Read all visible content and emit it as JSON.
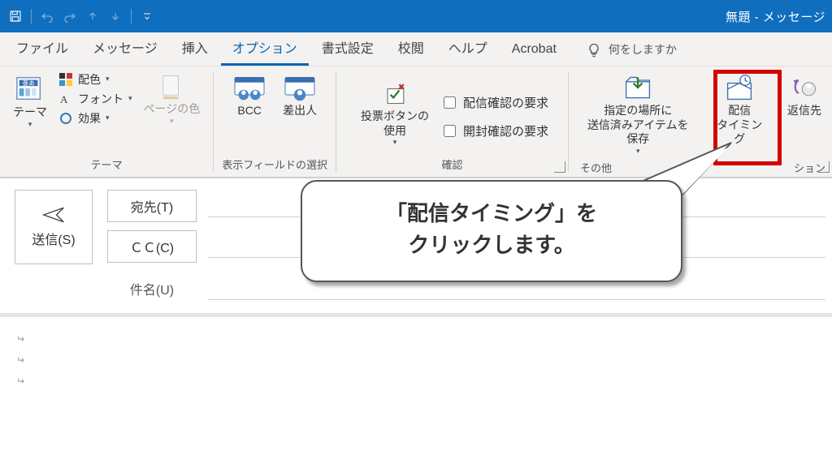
{
  "window": {
    "title": "無題 - メッセージ"
  },
  "tabs": {
    "file": "ファイル",
    "message": "メッセージ",
    "insert": "挿入",
    "options": "オプション",
    "format": "書式設定",
    "review": "校閲",
    "help": "ヘルプ",
    "acrobat": "Acrobat",
    "tellme": "何をしますか"
  },
  "ribbon": {
    "themes": {
      "group_label": "テーマ",
      "themes_btn": "テーマ",
      "colors": "配色",
      "fonts": "フォント",
      "effects": "効果",
      "page_color": "ページの色"
    },
    "show_fields": {
      "group_label": "表示フィールドの選択",
      "bcc": "BCC",
      "from": "差出人"
    },
    "tracking": {
      "group_label": "確認",
      "voting": "投票ボタンの\n使用",
      "delivery_receipt": "配信確認の要求",
      "read_receipt": "開封確認の要求"
    },
    "more_options": {
      "group_label_left": "その他",
      "group_label_right": "ション",
      "save_sent": "指定の場所に\n送信済みアイテムを保存",
      "delay": "配信\nタイミング",
      "direct_replies": "返信先"
    }
  },
  "compose": {
    "send": "送信(S)",
    "to": "宛先(T)",
    "cc": "ＣＣ(C)",
    "subject": "件名(U)"
  },
  "callout": {
    "line1": "「配信タイミング」を",
    "line2": "クリックします。"
  }
}
